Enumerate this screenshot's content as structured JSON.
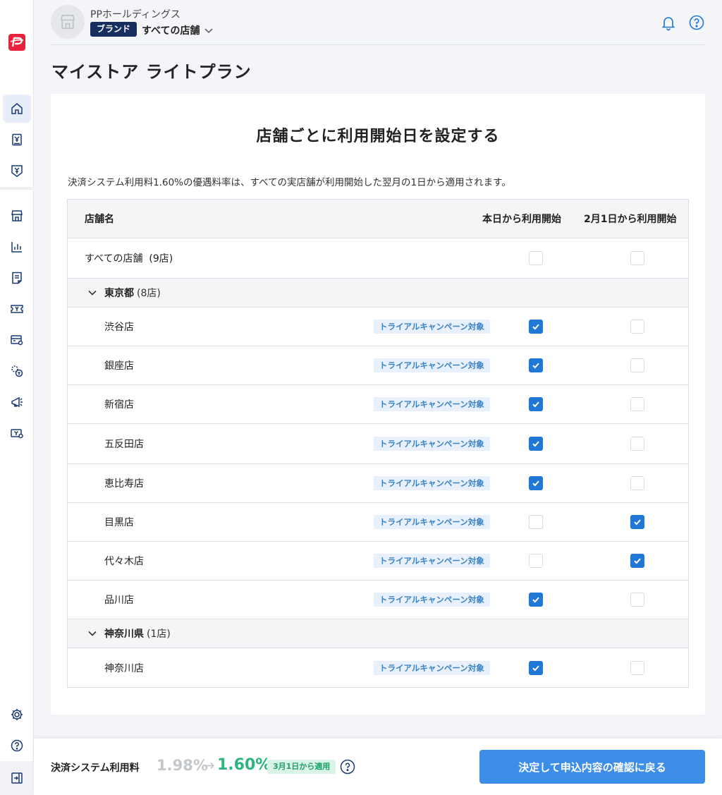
{
  "header": {
    "company_name": "PPホールディングス",
    "brand_badge": "ブランド",
    "store_selector": "すべての店舗"
  },
  "page_title": "マイストア ライトプラン",
  "card": {
    "title": "店舗ごとに利用開始日を設定する",
    "description": "決済システム利用料1.60%の優遇料率は、すべての実店舗が利用開始した翌月の1日から適用されます。"
  },
  "table": {
    "headers": {
      "store_name": "店舗名",
      "start_today": "本日から利用開始",
      "start_feb1": "2月1日から利用開始"
    },
    "all_stores": {
      "label": "すべての店舗",
      "count": "(9店)",
      "today": false,
      "feb1": false
    },
    "tag_label": "トライアルキャンペーン対象",
    "groups": [
      {
        "name": "東京都",
        "count": "(8店)",
        "stores": [
          {
            "name": "渋谷店",
            "today": true,
            "feb1": false
          },
          {
            "name": "銀座店",
            "today": true,
            "feb1": false
          },
          {
            "name": "新宿店",
            "today": true,
            "feb1": false
          },
          {
            "name": "五反田店",
            "today": true,
            "feb1": false
          },
          {
            "name": "恵比寿店",
            "today": true,
            "feb1": false
          },
          {
            "name": "目黒店",
            "today": false,
            "feb1": true
          },
          {
            "name": "代々木店",
            "today": false,
            "feb1": true
          },
          {
            "name": "品川店",
            "today": true,
            "feb1": false
          }
        ]
      },
      {
        "name": "神奈川県",
        "count": "(1店)",
        "stores": [
          {
            "name": "神奈川店",
            "today": true,
            "feb1": false
          }
        ]
      }
    ]
  },
  "footer": {
    "fee_label": "決済システム利用料",
    "fee_old": "1.98%",
    "fee_arrow": "→",
    "fee_new": "1.60%",
    "fee_badge": "3月1日から適用",
    "submit_button": "決定して申込内容の確認に戻る"
  },
  "colors": {
    "accent": "#1f78d6",
    "brand_badge": "#172e61",
    "button": "#3d8ee8",
    "fee_new": "#2cb67d",
    "logo": "#e8223b"
  },
  "icons": {
    "sidebar": [
      "home-icon",
      "receipt-yen-icon",
      "yen-shield-icon",
      "store-icon",
      "chart-icon",
      "document-icon",
      "ticket-icon",
      "card-settings-icon",
      "coin-search-icon",
      "megaphone-icon",
      "cash-settings-icon",
      "gear-icon",
      "help-icon",
      "logout-icon"
    ],
    "header": [
      "bell-icon",
      "help-icon"
    ]
  }
}
